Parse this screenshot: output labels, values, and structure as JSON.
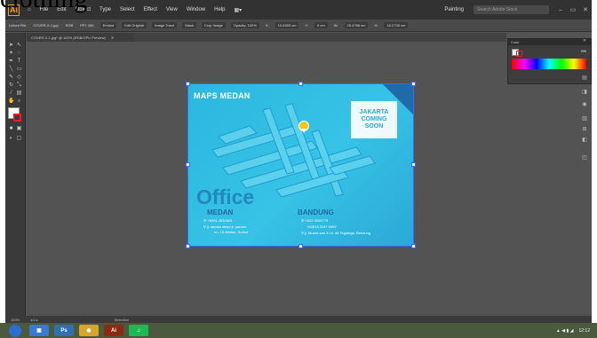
{
  "overlay_text": "clothing",
  "app": {
    "logo": "Ai",
    "menu": [
      "File",
      "Edit",
      "Object",
      "Type",
      "Select",
      "Effect",
      "View",
      "Window",
      "Help"
    ],
    "workspace": "Painting",
    "search_placeholder": "Search Adobe Stock"
  },
  "controlbar": {
    "items": [
      "Linked File",
      "COVER-X-1.jpg",
      "RGB",
      "PPI: 150",
      "Embed",
      "Edit Original",
      "Image Trace",
      "Mask",
      "Crop Image",
      "Opacity: 100%"
    ],
    "x": "10.6353 cm",
    "y": "9 cm",
    "w": "25.4786 cm",
    "h": "16.2735 cm"
  },
  "document": {
    "tab_label": "COVER-X-1.jpg* @ 100% (RGB/GPU Preview)"
  },
  "color_panel": {
    "title": "Color",
    "hex": "ffffff"
  },
  "artboard": {
    "title": "MAPS MEDAN",
    "coming_soon": [
      "JAKARTA",
      "COMING",
      "SOON"
    ],
    "office_label": "Office",
    "medan": {
      "city": "MEDAN",
      "phone": "+6261 4530604",
      "address": [
        "jl. sambu simpi jl. pardan",
        "no. 15 Medan, Sumut"
      ]
    },
    "bandung": {
      "city": "BANDUNG",
      "phone": "+022 5205775",
      "phone2": "+62813 2197 6999",
      "address": "jl. Muara sari 3 no. 48 Tegalega, Bandung"
    },
    "colors": {
      "primary": "#2bb7df",
      "dark": "#1f6aa8",
      "pin": "#f5c518"
    }
  },
  "status": {
    "zoom": "100%",
    "page": "1",
    "tool": "Selection"
  },
  "taskbar": {
    "time": "12:12"
  }
}
